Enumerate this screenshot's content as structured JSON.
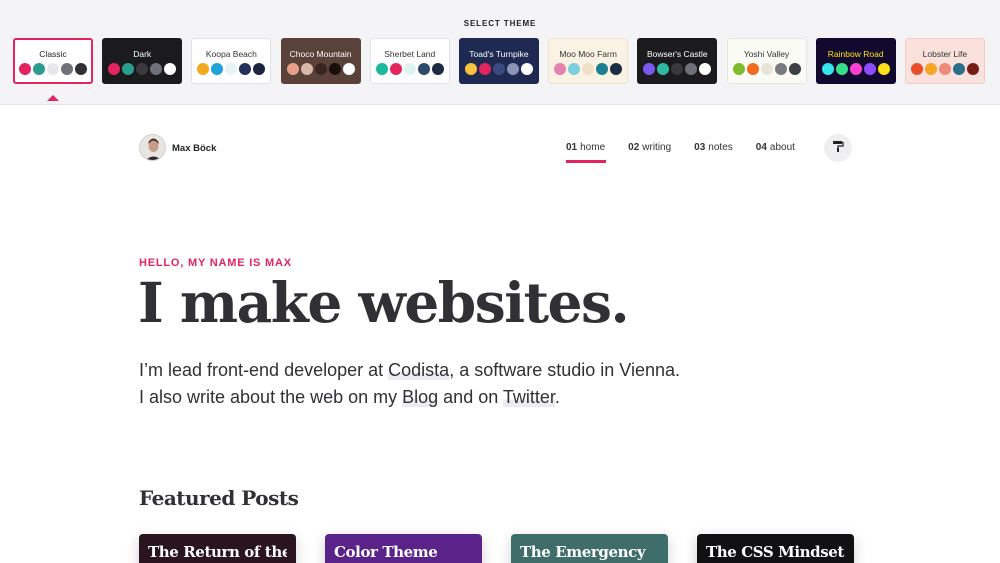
{
  "theme_picker": {
    "title": "SELECT THEME",
    "themes": [
      {
        "name": "Classic",
        "bg": "#ffffff",
        "text": "#222222",
        "border": "#e3245e",
        "swatches": [
          "#e3245e",
          "#2a9d8f",
          "#e8e8ea",
          "#6d7278",
          "#313135"
        ]
      },
      {
        "name": "Dark",
        "bg": "#1b1b1e",
        "text": "#ffffff",
        "border": "#1b1b1e",
        "swatches": [
          "#e3245e",
          "#2a9d8f",
          "#3a3a3e",
          "#6d7278",
          "#ffffff"
        ]
      },
      {
        "name": "Koopa Beach",
        "bg": "#ffffff",
        "text": "#333333",
        "border": "#e2e2e6",
        "swatches": [
          "#f4a81d",
          "#1ea3d6",
          "#e6f4f8",
          "#23315c",
          "#1c2540"
        ]
      },
      {
        "name": "Choco Mountain",
        "bg": "#5a4139",
        "text": "#ffffff",
        "border": "#5a4139",
        "swatches": [
          "#e8a08a",
          "#d9b8a8",
          "#3a2620",
          "#1a0f0b",
          "#ffffff"
        ]
      },
      {
        "name": "Sherbet Land",
        "bg": "#ffffff",
        "text": "#333333",
        "border": "#e2e2e6",
        "swatches": [
          "#1cb89a",
          "#e3245e",
          "#dff3f0",
          "#2c4a6b",
          "#1b2a40"
        ]
      },
      {
        "name": "Toad's Turnpike",
        "bg": "#1e2a52",
        "text": "#ffffff",
        "border": "#1e2a52",
        "swatches": [
          "#f6c33c",
          "#e3245e",
          "#3a4a80",
          "#8a95b8",
          "#ffffff"
        ]
      },
      {
        "name": "Moo Moo Farm",
        "bg": "#faf3e3",
        "text": "#333333",
        "border": "#ece5d4",
        "swatches": [
          "#e583b0",
          "#7ccfdc",
          "#f0e0c8",
          "#1a7f8e",
          "#1d2c45"
        ]
      },
      {
        "name": "Bowser's Castle",
        "bg": "#1b1b1e",
        "text": "#ffffff",
        "border": "#1b1b1e",
        "swatches": [
          "#7b58f0",
          "#2fb9a6",
          "#3a3a3e",
          "#6d7278",
          "#ffffff"
        ]
      },
      {
        "name": "Yoshi Valley",
        "bg": "#fbfbf5",
        "text": "#333333",
        "border": "#e6e6dc",
        "swatches": [
          "#7dbb2c",
          "#f26a1b",
          "#e8e5d8",
          "#7a7a80",
          "#3a3e45"
        ]
      },
      {
        "name": "Rainbow Road",
        "bg": "#120a2e",
        "text": "#ffe01a",
        "border": "#120a2e",
        "swatches": [
          "#34e6f0",
          "#35e08a",
          "#ff3fd0",
          "#8c4cff",
          "#ffe01a"
        ]
      },
      {
        "name": "Lobster Life",
        "bg": "#fbe1dc",
        "text": "#333333",
        "border": "#f0cdc6",
        "swatches": [
          "#e94e2b",
          "#f5a623",
          "#ef8a7a",
          "#2a6f8a",
          "#7a1c16"
        ]
      }
    ]
  },
  "header": {
    "author": "Max Böck",
    "nav": [
      {
        "num": "01",
        "label": "home",
        "active": true
      },
      {
        "num": "02",
        "label": "writing",
        "active": false
      },
      {
        "num": "03",
        "label": "notes",
        "active": false
      },
      {
        "num": "04",
        "label": "about",
        "active": false
      }
    ]
  },
  "hero": {
    "eyebrow": "HELLO, MY NAME IS MAX",
    "title": "I make websites.",
    "line1_pre": "I’m lead front-end developer at ",
    "line1_link": "Codista",
    "line1_post": ", a software studio in Vienna.",
    "line2_pre": "I also write about the web on my ",
    "line2_link1": "Blog",
    "line2_mid": " and on ",
    "line2_link2": "Twitter",
    "line2_post": "."
  },
  "featured": {
    "title": "Featured Posts",
    "posts": [
      {
        "title": "The Return of the",
        "color": "#2a1420"
      },
      {
        "title": "Color Theme",
        "color": "#5a2389"
      },
      {
        "title": "The Emergency",
        "color": "#3f6e6a"
      },
      {
        "title": "The CSS Mindset",
        "color": "#111113"
      }
    ]
  },
  "colors": {
    "accent": "#e3245e",
    "text": "#313135"
  }
}
